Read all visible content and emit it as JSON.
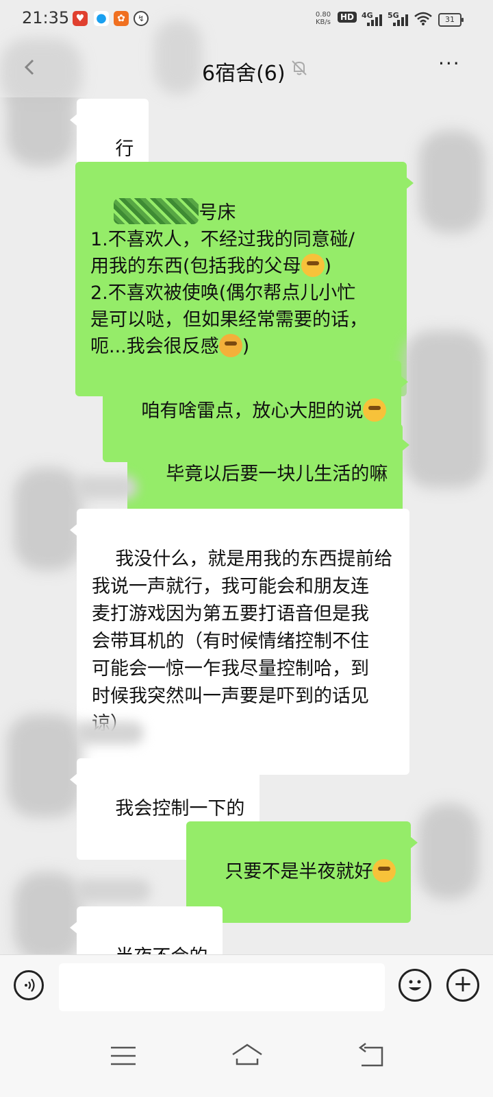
{
  "status_bar": {
    "time": "21:35",
    "net_speed_value": "0.80",
    "net_speed_unit": "KB/s",
    "hd": "HD",
    "sim1_label": "4G",
    "sim2_label": "5G",
    "battery_level": "31",
    "notification_icons": [
      "red-app-icon",
      "qq-penguin-icon",
      "orange-app-icon",
      "circle-app-icon"
    ]
  },
  "header": {
    "title": "6宿舍(6)",
    "muted_icon": "bell-off-icon",
    "more_icon": "more-dots-icon",
    "back_icon": "back-arrow-icon"
  },
  "messages": [
    {
      "side": "in",
      "text": "行"
    },
    {
      "side": "out",
      "text_1": "号床",
      "text_2": "1.不喜欢人，不经过我的同意碰/\n用我的东西(包括我的父母",
      "text_3": ")\n2.不喜欢被使唤(偶尔帮点儿小忙\n是可以哒，但如果经常需要的话，\n呃...我会很反感",
      "text_4": ")"
    },
    {
      "side": "out",
      "text": "咱有啥雷点，放心大胆的说"
    },
    {
      "side": "out",
      "text": "毕竟以后要一块儿生活的嘛"
    },
    {
      "side": "in",
      "text": "我没什么，就是用我的东西提前给\n我说一声就行，我可能会和朋友连\n麦打游戏因为第五要打语音但是我\n会带耳机的（有时候情绪控制不住\n可能会一惊一乍我尽量控制哈，到\n时候我突然叫一声要是吓到的话见\n谅）"
    },
    {
      "side": "in",
      "text": "我会控制一下的"
    },
    {
      "side": "out",
      "text": "只要不是半夜就好"
    },
    {
      "side": "in",
      "text": "半夜不会的"
    }
  ],
  "input_bar": {
    "voice_icon": "voice-icon",
    "emoji_icon": "smile-icon",
    "plus_icon": "plus-icon",
    "placeholder": ""
  },
  "nav_bar": {
    "icons": [
      "menu-icon",
      "home-icon",
      "back-icon"
    ]
  },
  "colors": {
    "background": "#ededed",
    "outgoing_bubble": "#95ec69",
    "incoming_bubble": "#ffffff"
  }
}
